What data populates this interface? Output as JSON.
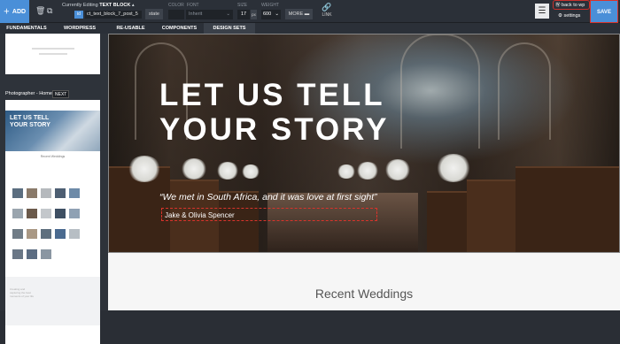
{
  "toolbar": {
    "add_label": "ADD",
    "editing_prefix": "Currently Editing",
    "editing_type": "TEXT BLOCK",
    "id_badge": "id",
    "selector_value": "ct_text_block_7_post_5",
    "state_label": "state",
    "color_label": "COLOR",
    "font_label": "FONT",
    "font_value": "Inherit",
    "size_label": "SIZE",
    "size_value": "17",
    "size_unit": "px",
    "weight_label": "WEIGHT",
    "weight_value": "600",
    "more_label": "MORE",
    "link_label": "LINK",
    "back_label": "back to wp",
    "settings_label": "settings",
    "save_label": "SAVE",
    "annotation_number": "1"
  },
  "tabs": [
    {
      "label": "FUNDAMENTALS"
    },
    {
      "label": "WORDPRESS"
    },
    {
      "label": "RE-USABLE"
    },
    {
      "label": "COMPONENTS"
    },
    {
      "label": "DESIGN SETS",
      "active": true
    }
  ],
  "sidebar": {
    "design_title": "Photographer - Home",
    "next_label": "NEXT",
    "preview_title": "LET US TELL YOUR STORY",
    "preview_sub": "Recent Weddings",
    "preview_block_text": "Creating and capturing the best moments of your life"
  },
  "main": {
    "hero_title_line1": "LET US TELL",
    "hero_title_line2": "YOUR STORY",
    "quote": "“We met in South Africa, and it was love at first sight”",
    "author": "Jake & Olivia Spencer",
    "section_title": "Recent Weddings"
  },
  "colors": {
    "accent_blue": "#4a8fd8",
    "toolbar_bg": "#2b3038",
    "highlight_red": "#d9332b"
  }
}
